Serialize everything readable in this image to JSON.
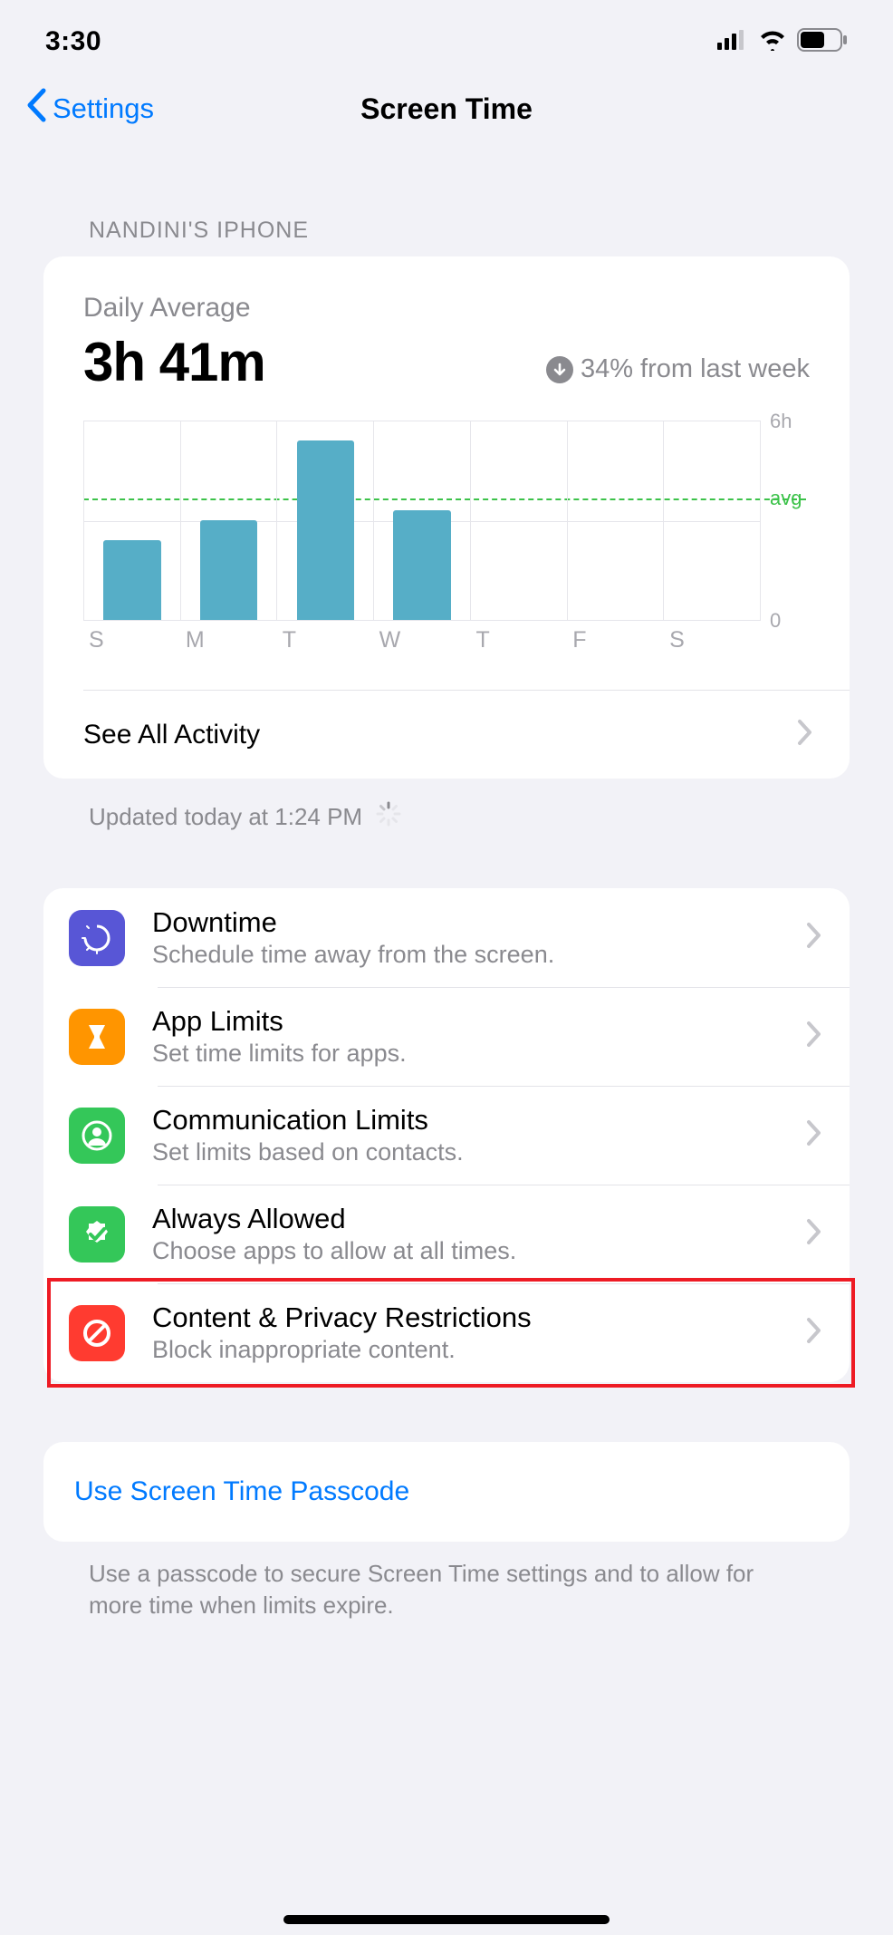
{
  "status": {
    "time": "3:30"
  },
  "nav": {
    "back_label": "Settings",
    "title": "Screen Time"
  },
  "device_header": "NANDINI'S IPHONE",
  "summary": {
    "daily_avg_label": "Daily Average",
    "daily_avg_value": "3h 41m",
    "trend_text": "34% from last week",
    "see_all_label": "See All Activity",
    "updated_text": "Updated today at 1:24 PM"
  },
  "chart_data": {
    "type": "bar",
    "categories": [
      "S",
      "M",
      "T",
      "W",
      "T",
      "F",
      "S"
    ],
    "values": [
      2.4,
      3.0,
      5.4,
      3.3,
      0,
      0,
      0
    ],
    "ylim": [
      0,
      6
    ],
    "yticks": [
      {
        "v": 6,
        "label": "6h"
      },
      {
        "v": 0,
        "label": "0"
      }
    ],
    "avg_line": {
      "value": 3.68,
      "label": "avg"
    },
    "xlabel": "",
    "ylabel": ""
  },
  "rows": [
    {
      "key": "downtime",
      "title": "Downtime",
      "sub": "Schedule time away from the screen.",
      "icon_color": "#5856d6"
    },
    {
      "key": "app-limits",
      "title": "App Limits",
      "sub": "Set time limits for apps.",
      "icon_color": "#ff9500"
    },
    {
      "key": "communication-limits",
      "title": "Communication Limits",
      "sub": "Set limits based on contacts.",
      "icon_color": "#34c759"
    },
    {
      "key": "always-allowed",
      "title": "Always Allowed",
      "sub": "Choose apps to allow at all times.",
      "icon_color": "#34c759"
    },
    {
      "key": "content-privacy",
      "title": "Content & Privacy Restrictions",
      "sub": "Block inappropriate content.",
      "icon_color": "#ff3b30"
    }
  ],
  "passcode": {
    "button_label": "Use Screen Time Passcode",
    "footer": "Use a passcode to secure Screen Time settings and to allow for more time when limits expire."
  }
}
